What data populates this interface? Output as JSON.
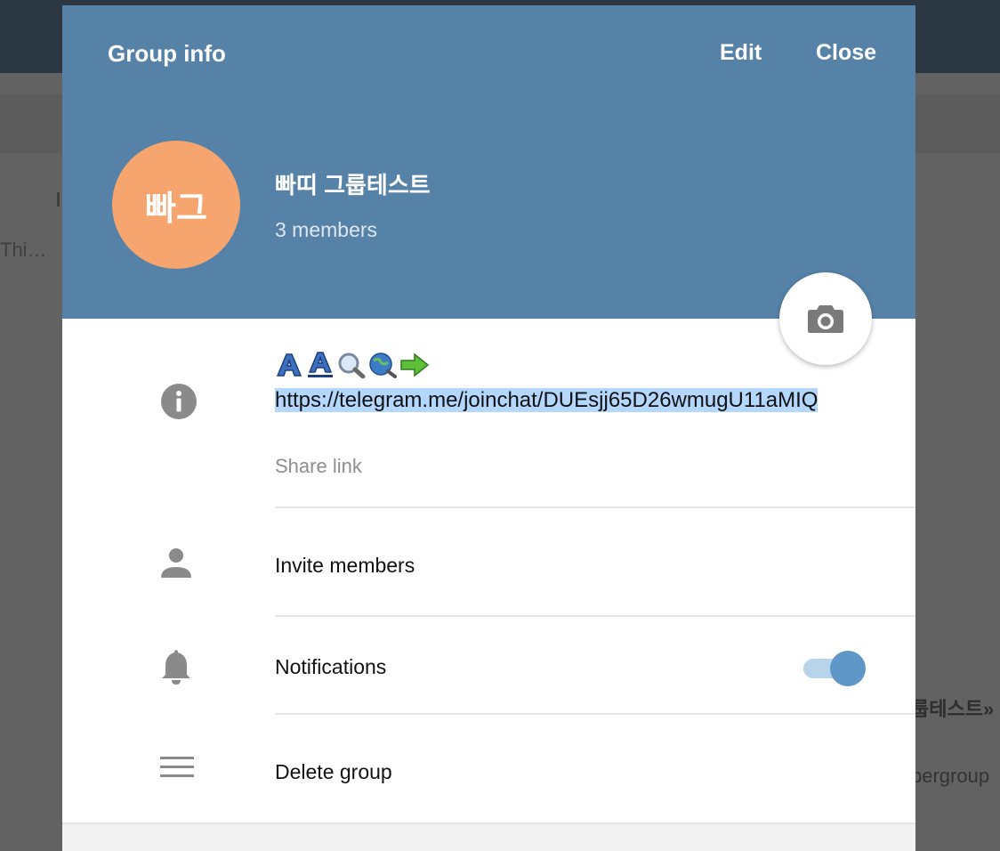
{
  "background": {
    "left_text": "Thi…",
    "right_text_1": "룹테스트»",
    "right_text_2": "pergroup"
  },
  "header": {
    "title": "Group info",
    "edit_label": "Edit",
    "close_label": "Close",
    "bg_color": "#5682a8"
  },
  "group": {
    "avatar_initials": "빠그",
    "avatar_color": "#f7a56e",
    "name": "빠띠 그룹테스트",
    "members": "3 members"
  },
  "info": {
    "link": "https://telegram.me/joinchat/DUEsjj65D26wmugU11aMIQ",
    "share_label": "Share link",
    "emoji_icons": [
      "font-a-icon",
      "font-a-underline-icon",
      "magnifier-icon",
      "globe-search-icon",
      "green-arrow-icon"
    ]
  },
  "actions": {
    "invite_label": "Invite members",
    "notifications_label": "Notifications",
    "notifications_enabled": true,
    "delete_label": "Delete group"
  }
}
